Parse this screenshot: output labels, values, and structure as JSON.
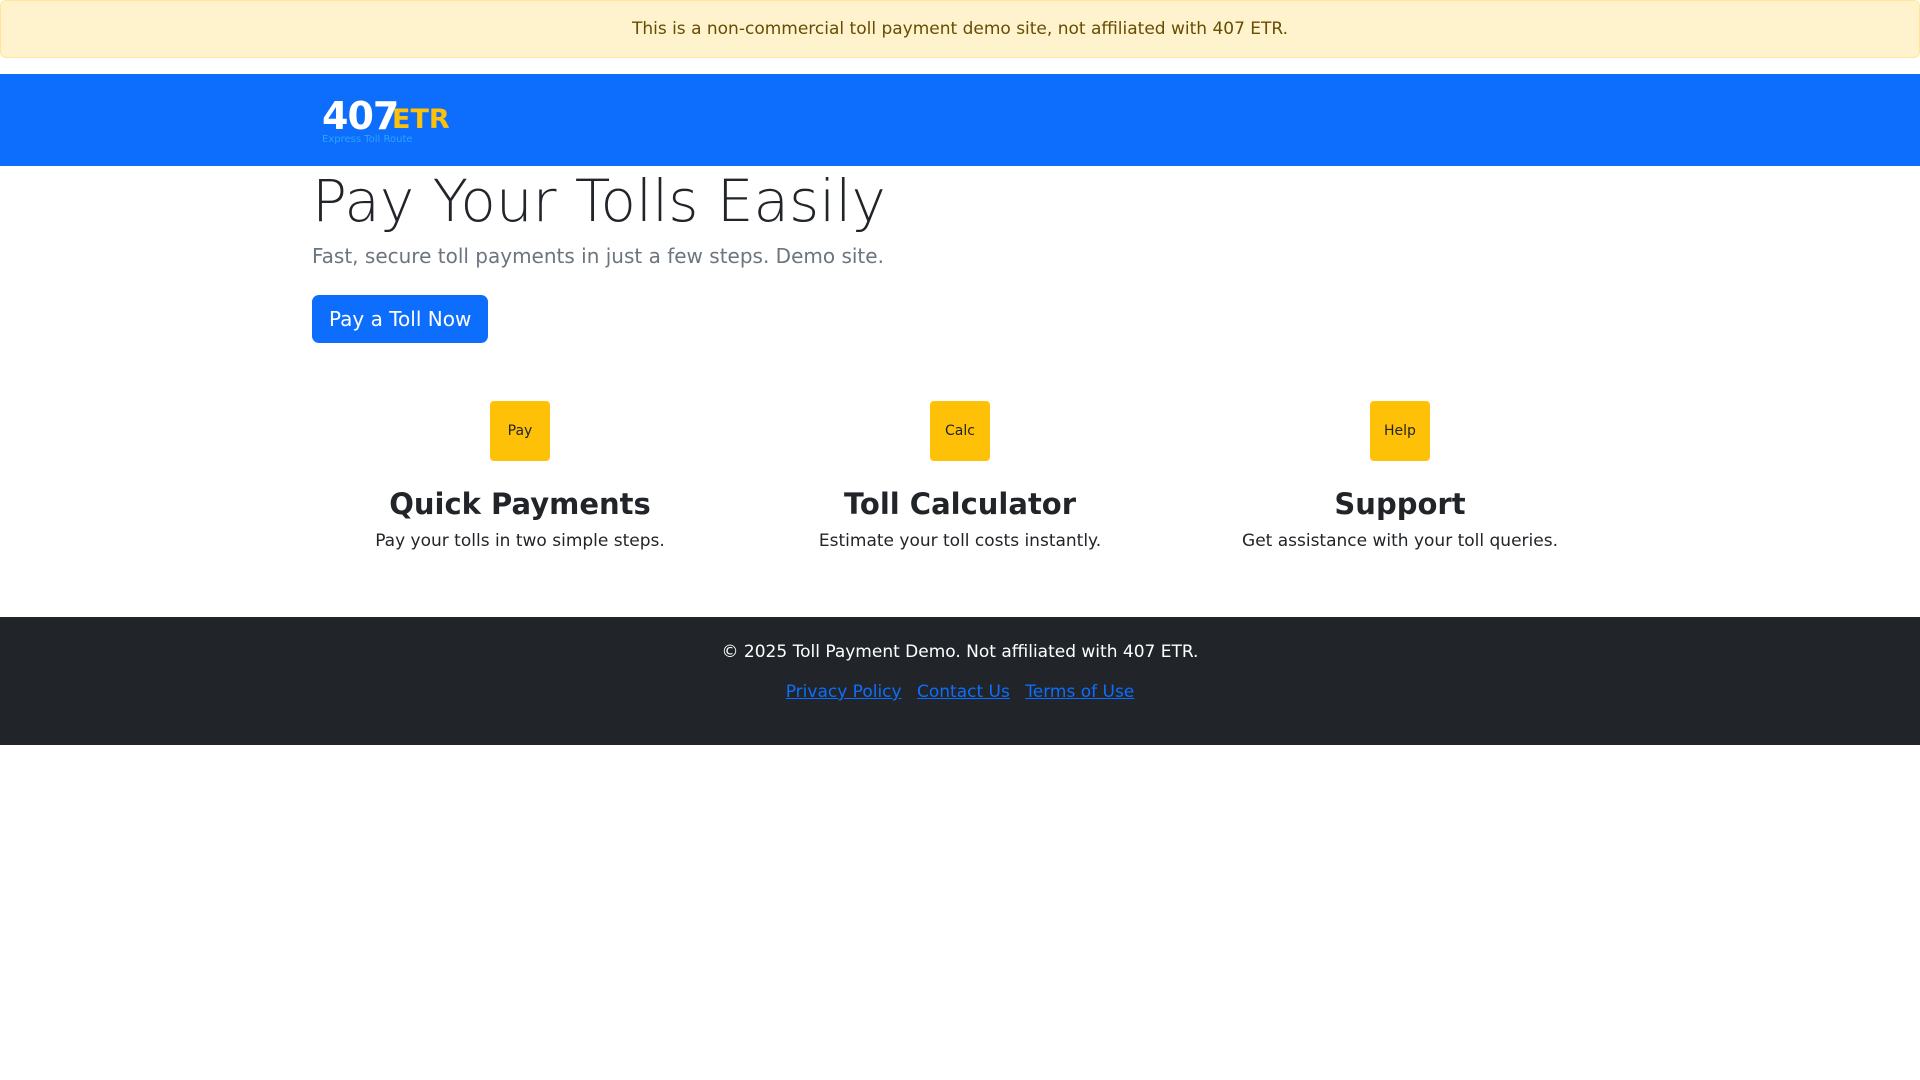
{
  "alert": {
    "text": "This is a non-commercial toll payment demo site, not affiliated with 407 ETR."
  },
  "header": {
    "logo": {
      "number": "407",
      "suffix": "ETR",
      "tagline": "Express Toll Route"
    }
  },
  "hero": {
    "title": "Pay Your Tolls Easily",
    "subtitle": "Fast, secure toll payments in just a few steps. Demo site.",
    "cta_label": "Pay a Toll Now"
  },
  "features": [
    {
      "icon_label": "Pay",
      "title": "Quick Payments",
      "description": "Pay your tolls in two simple steps."
    },
    {
      "icon_label": "Calc",
      "title": "Toll Calculator",
      "description": "Estimate your toll costs instantly."
    },
    {
      "icon_label": "Help",
      "title": "Support",
      "description": "Get assistance with your toll queries."
    }
  ],
  "footer": {
    "copyright": "© 2025 Toll Payment Demo. Not affiliated with 407 ETR.",
    "links": [
      "Privacy Policy",
      "Contact Us",
      "Terms of Use"
    ]
  },
  "colors": {
    "primary": "#0d6efd",
    "accent": "#ffc107",
    "footer_bg": "#212529",
    "alert_bg": "#fff3cd",
    "alert_text": "#664d03"
  }
}
